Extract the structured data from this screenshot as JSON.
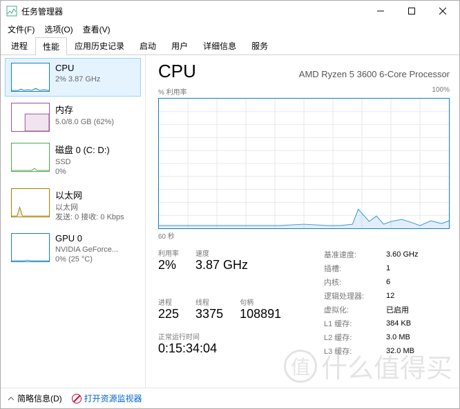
{
  "window": {
    "title": "任务管理器"
  },
  "menu": {
    "file": "文件(F)",
    "options": "选项(O)",
    "view": "查看(V)"
  },
  "tabs": [
    "进程",
    "性能",
    "应用历史记录",
    "启动",
    "用户",
    "详细信息",
    "服务"
  ],
  "sidebar": [
    {
      "name": "CPU",
      "sub1": "2% 3.87 GHz",
      "sub2": "",
      "color": "#117dbb"
    },
    {
      "name": "内存",
      "sub1": "5.0/8.0 GB (62%)",
      "sub2": "",
      "color": "#9b4f96"
    },
    {
      "name": "磁盘 0 (C: D:)",
      "sub1": "SSD",
      "sub2": "0%",
      "color": "#4ca64c"
    },
    {
      "name": "以太网",
      "sub1": "以太网",
      "sub2": "发送: 0 接收: 0 Kbps",
      "color": "#a67c00"
    },
    {
      "name": "GPU 0",
      "sub1": "NVIDIA GeForce...",
      "sub2": "0% (25 °C)",
      "color": "#117dbb"
    }
  ],
  "main": {
    "title": "CPU",
    "model": "AMD Ryzen 5 3600 6-Core Processor",
    "graph_left": "% 利用率",
    "graph_right": "100%",
    "xaxis": "60 秒",
    "stats": {
      "util_lbl": "利用率",
      "util_val": "2%",
      "speed_lbl": "速度",
      "speed_val": "3.87 GHz",
      "proc_lbl": "进程",
      "proc_val": "225",
      "thread_lbl": "线程",
      "thread_val": "3375",
      "handle_lbl": "句柄",
      "handle_val": "108891",
      "uptime_lbl": "正常运行时间",
      "uptime_val": "0:15:34:04"
    },
    "right": {
      "base_lbl": "基准速度:",
      "base_val": "3.60 GHz",
      "sockets_lbl": "插槽:",
      "sockets_val": "1",
      "cores_lbl": "内核:",
      "cores_val": "6",
      "lproc_lbl": "逻辑处理器:",
      "lproc_val": "12",
      "virt_lbl": "虚拟化:",
      "virt_val": "已启用",
      "l1_lbl": "L1 缓存:",
      "l1_val": "384 KB",
      "l2_lbl": "L2 缓存:",
      "l2_val": "3.0 MB",
      "l3_lbl": "L3 缓存:",
      "l3_val": "32.0 MB"
    }
  },
  "footer": {
    "fewer": "简略信息(D)",
    "resmon": "打开资源监视器"
  },
  "watermark": {
    "icon": "值",
    "text": "什么值得买"
  },
  "chart_data": {
    "type": "line",
    "title": "% 利用率",
    "xlabel": "60 秒",
    "ylabel": "",
    "ylim": [
      0,
      100
    ],
    "x": [
      0,
      5,
      10,
      15,
      20,
      25,
      30,
      35,
      40,
      45,
      50,
      53,
      55,
      57,
      60
    ],
    "values": [
      2,
      2,
      2,
      2,
      2,
      2,
      3,
      2,
      2,
      3,
      15,
      5,
      10,
      4,
      6
    ]
  }
}
